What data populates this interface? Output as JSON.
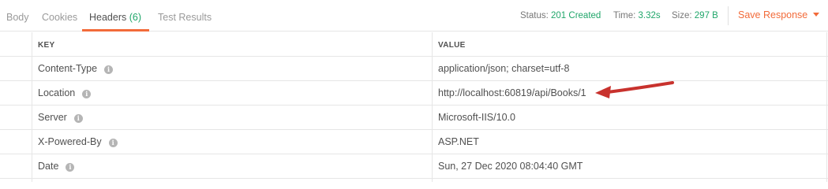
{
  "tabs": [
    {
      "label": "Body"
    },
    {
      "label": "Cookies"
    },
    {
      "label": "Headers",
      "count": "(6)"
    },
    {
      "label": "Test Results"
    }
  ],
  "status": {
    "status_label": "Status:",
    "status_value": "201 Created",
    "time_label": "Time:",
    "time_value": "3.32s",
    "size_label": "Size:",
    "size_value": "297 B"
  },
  "save_response_label": "Save Response",
  "table": {
    "columns": [
      "KEY",
      "VALUE"
    ],
    "rows": [
      {
        "key": "Content-Type",
        "value": "application/json; charset=utf-8"
      },
      {
        "key": "Location",
        "value": "http://localhost:60819/api/Books/1"
      },
      {
        "key": "Server",
        "value": "Microsoft-IIS/10.0"
      },
      {
        "key": "X-Powered-By",
        "value": "ASP.NET"
      },
      {
        "key": "Date",
        "value": "Sun, 27 Dec 2020 08:04:40 GMT"
      }
    ]
  },
  "colors": {
    "accent": "#f26b3a",
    "success": "#20a66a",
    "annotation_arrow": "#c8322d"
  },
  "icons": {
    "info": "info-icon",
    "dropdown": "chevron-down-icon",
    "annotation": "arrow-annotation-icon"
  }
}
